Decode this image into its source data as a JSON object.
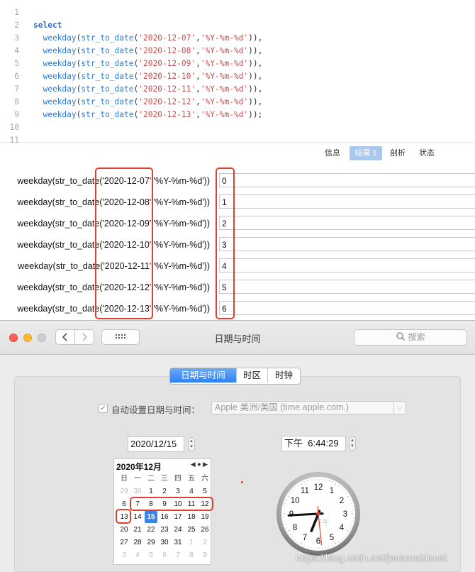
{
  "editor": {
    "lines": [
      {
        "num": "1",
        "code": ""
      },
      {
        "num": "2",
        "code": "select"
      },
      {
        "num": "3",
        "code": "  weekday(str_to_date('2020-12-07','%Y-%m-%d')),"
      },
      {
        "num": "4",
        "code": "  weekday(str_to_date('2020-12-08','%Y-%m-%d')),"
      },
      {
        "num": "5",
        "code": "  weekday(str_to_date('2020-12-09','%Y-%m-%d')),"
      },
      {
        "num": "6",
        "code": "  weekday(str_to_date('2020-12-10','%Y-%m-%d')),"
      },
      {
        "num": "7",
        "code": "  weekday(str_to_date('2020-12-11','%Y-%m-%d')),"
      },
      {
        "num": "8",
        "code": "  weekday(str_to_date('2020-12-12','%Y-%m-%d')),"
      },
      {
        "num": "9",
        "code": "  weekday(str_to_date('2020-12-13','%Y-%m-%d'));"
      },
      {
        "num": "10",
        "code": ""
      },
      {
        "num": "11",
        "code": ""
      }
    ]
  },
  "result_tabs": [
    {
      "label": "信息",
      "active": false
    },
    {
      "label": "结果 1",
      "active": true
    },
    {
      "label": "剖析",
      "active": false
    },
    {
      "label": "状态",
      "active": false
    }
  ],
  "results": {
    "rows": [
      {
        "label": "weekday(str_to_date('2020-12-07','%Y-%m-%d'))",
        "value": "0"
      },
      {
        "label": "weekday(str_to_date('2020-12-08','%Y-%m-%d'))",
        "value": "1"
      },
      {
        "label": "weekday(str_to_date('2020-12-09','%Y-%m-%d'))",
        "value": "2"
      },
      {
        "label": "weekday(str_to_date('2020-12-10','%Y-%m-%d'))",
        "value": "3"
      },
      {
        "label": "weekday(str_to_date('2020-12-11','%Y-%m-%d'))",
        "value": "4"
      },
      {
        "label": "weekday(str_to_date('2020-12-12','%Y-%m-%d'))",
        "value": "5"
      },
      {
        "label": "weekday(str_to_date('2020-12-13','%Y-%m-%d'))",
        "value": "6"
      }
    ]
  },
  "window": {
    "title": "日期与时间",
    "search_placeholder": "搜索",
    "grid_icon": "grid-icon",
    "tabs": [
      {
        "label": "日期与时间",
        "active": true
      },
      {
        "label": "时区",
        "active": false
      },
      {
        "label": "时钟",
        "active": false
      }
    ],
    "auto_label": "自动设置日期与时间：",
    "auto_checked": true,
    "server": "Apple 美洲/美国 (time.apple.com.)",
    "date_value": "2020/12/15",
    "time_value": "下午  6:44:29",
    "clock_ampm": "下午",
    "calendar": {
      "header": "2020年12月",
      "weekdays": [
        "日",
        "一",
        "二",
        "三",
        "四",
        "五",
        "六"
      ],
      "weeks": [
        [
          "29",
          "30",
          "1",
          "2",
          "3",
          "4",
          "5"
        ],
        [
          "6",
          "7",
          "8",
          "9",
          "10",
          "11",
          "12"
        ],
        [
          "13",
          "14",
          "15",
          "16",
          "17",
          "18",
          "19"
        ],
        [
          "20",
          "21",
          "22",
          "23",
          "24",
          "25",
          "26"
        ],
        [
          "27",
          "28",
          "29",
          "30",
          "31",
          "1",
          "2"
        ],
        [
          "3",
          "4",
          "5",
          "6",
          "7",
          "8",
          "9"
        ]
      ],
      "selected": "15"
    }
  },
  "watermark": "https://blog.csdn.net/javaanddonet",
  "colors": {
    "highlight": "#e0412f",
    "accent": "#3b83ec"
  }
}
